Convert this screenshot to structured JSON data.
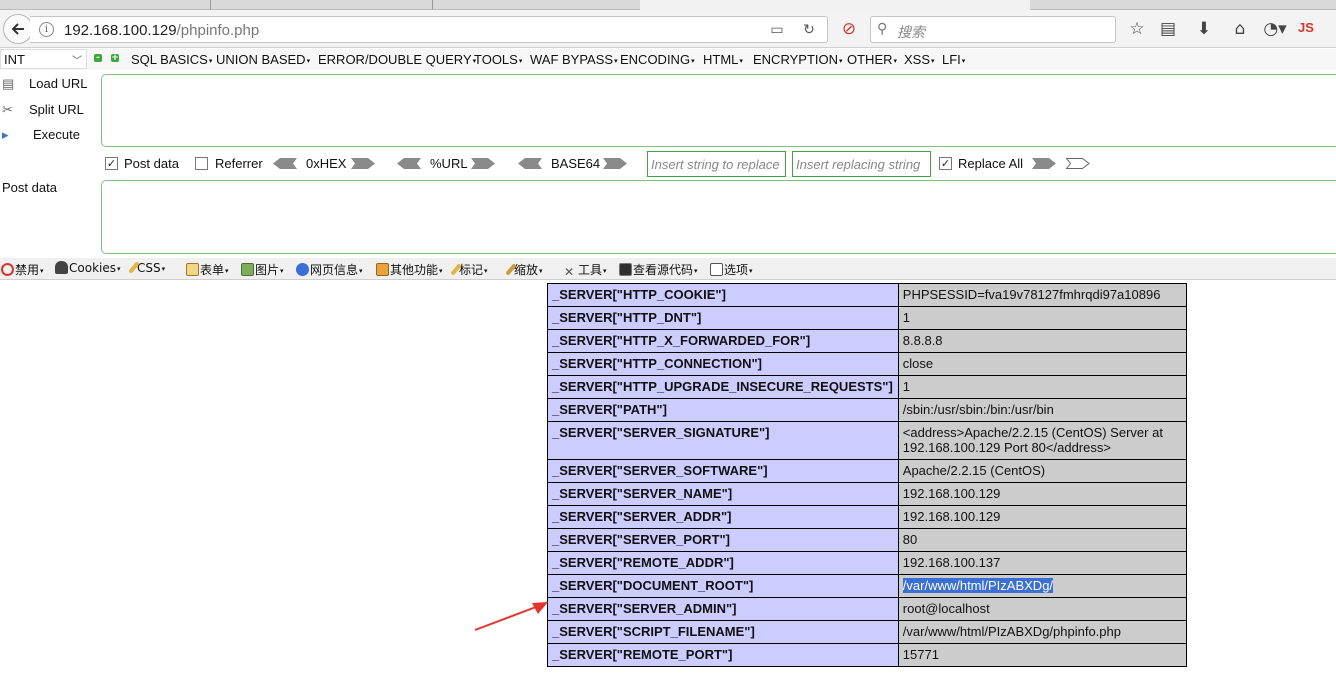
{
  "browser": {
    "url_host": "192.168.100.129",
    "url_path": "/phpinfo.php",
    "search_placeholder": "搜索",
    "js_label": "JS"
  },
  "hackbar": {
    "select_value": "INT",
    "menus": [
      "SQL BASICS",
      "UNION BASED",
      "ERROR/DOUBLE QUERY",
      "TOOLS",
      "WAF BYPASS",
      "ENCODING",
      "HTML",
      "ENCRYPTION",
      "OTHER",
      "XSS",
      "LFI"
    ],
    "load_url": "Load URL",
    "split_url": "Split URL",
    "execute": "Execute",
    "post_data_check": "Post data",
    "referrer_check": "Referrer",
    "hex_label": "0xHEX",
    "url_label": "%URL",
    "base64_label": "BASE64",
    "replace_placeholder": "Insert string to replace",
    "replacing_placeholder": "Insert replacing string",
    "replace_all": "Replace All",
    "post_data_label": "Post data",
    "post_data_checked": true,
    "referrer_checked": false,
    "replace_all_checked": true
  },
  "devbar": {
    "items": [
      "禁用",
      "Cookies",
      "CSS",
      "表单",
      "图片",
      "网页信息",
      "其他功能",
      "标记",
      "缩放",
      "工具",
      "查看源代码",
      "选项"
    ]
  },
  "phpinfo": {
    "rows": [
      {
        "key": "_SERVER[\"HTTP_COOKIE\"]",
        "value": "PHPSESSID=fva19v78127fmhrqdi97a10896"
      },
      {
        "key": "_SERVER[\"HTTP_DNT\"]",
        "value": "1"
      },
      {
        "key": "_SERVER[\"HTTP_X_FORWARDED_FOR\"]",
        "value": "8.8.8.8"
      },
      {
        "key": "_SERVER[\"HTTP_CONNECTION\"]",
        "value": "close"
      },
      {
        "key": "_SERVER[\"HTTP_UPGRADE_INSECURE_REQUESTS\"]",
        "value": "1"
      },
      {
        "key": "_SERVER[\"PATH\"]",
        "value": "/sbin:/usr/sbin:/bin:/usr/bin"
      },
      {
        "key": "_SERVER[\"SERVER_SIGNATURE\"]",
        "value": "<address>Apache/2.2.15 (CentOS) Server at 192.168.100.129 Port 80</address>"
      },
      {
        "key": "_SERVER[\"SERVER_SOFTWARE\"]",
        "value": "Apache/2.2.15 (CentOS)"
      },
      {
        "key": "_SERVER[\"SERVER_NAME\"]",
        "value": "192.168.100.129"
      },
      {
        "key": "_SERVER[\"SERVER_ADDR\"]",
        "value": "192.168.100.129"
      },
      {
        "key": "_SERVER[\"SERVER_PORT\"]",
        "value": "80"
      },
      {
        "key": "_SERVER[\"REMOTE_ADDR\"]",
        "value": "192.168.100.137"
      },
      {
        "key": "_SERVER[\"DOCUMENT_ROOT\"]",
        "value": "/var/www/html/PIzABXDg/",
        "highlighted": true
      },
      {
        "key": "_SERVER[\"SERVER_ADMIN\"]",
        "value": "root@localhost"
      },
      {
        "key": "_SERVER[\"SCRIPT_FILENAME\"]",
        "value": "/var/www/html/PIzABXDg/phpinfo.php"
      },
      {
        "key": "_SERVER[\"REMOTE_PORT\"]",
        "value": "15771"
      }
    ],
    "colors": {
      "key_bg": "#ccccff",
      "value_bg": "#cccccc",
      "highlight": "#3a6fd8",
      "arrow": "#e8322a"
    }
  }
}
